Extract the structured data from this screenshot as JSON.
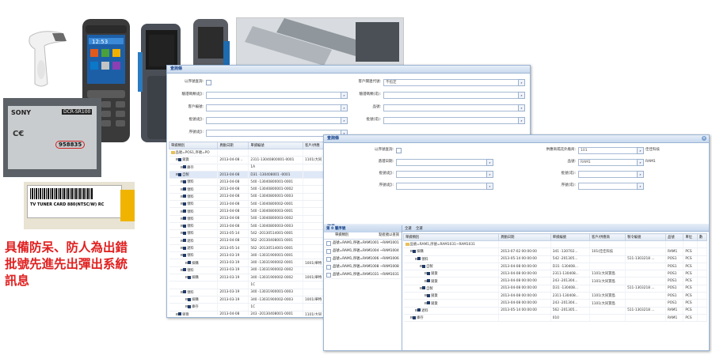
{
  "caption_lines": [
    "具備防呆、防人為出錯",
    "批號先進先出彈出系統",
    "訊息"
  ],
  "photos": {
    "device_label_brand": "SONY",
    "device_label_model": "DCR-SR100",
    "device_label_serial": "958835",
    "box_label_text": "TV TUNER CARD 880(NTSC/W) RC",
    "phone_time": "12:53"
  },
  "win1": {
    "title": "查詢條",
    "form_left": [
      {
        "label": "以序號查詢:",
        "type": "checkbox"
      },
      {
        "label": "驗證碼類(起):",
        "value": ""
      },
      {
        "label": "客戶編號:",
        "value": ""
      },
      {
        "label": "批號(起):",
        "value": ""
      },
      {
        "label": "序號(起):",
        "value": ""
      }
    ],
    "form_right": [
      {
        "label": "客戶關連代號:",
        "value": "不指定"
      },
      {
        "label": "驗證碼類(迄):",
        "value": ""
      },
      {
        "label": "品號:",
        "value": ""
      },
      {
        "label": "批號(迄):",
        "value": ""
      }
    ],
    "headers": [
      "單據類別",
      "異動日期",
      "單據編號",
      "客戶/供應"
    ],
    "rows": [
      {
        "tree": "品號=POS1,序號=PO",
        "date": "",
        "no": "",
        "cust": "",
        "level": 0,
        "icon": "folder"
      },
      {
        "tree": "銷貨",
        "date": "2013-04-08 ..",
        "no": "2311-13040800001-0001",
        "cust": "1101(大同",
        "level": 1,
        "icon": "node"
      },
      {
        "tree": "庫存",
        "date": "",
        "no": "1A",
        "cust": "",
        "level": 2,
        "icon": "node"
      },
      {
        "tree": "自製",
        "date": "2013-04-08",
        "no": "D31 -130408001 -0001",
        "cust": "",
        "level": 1,
        "icon": "node",
        "selected": true
      },
      {
        "tree": "領料",
        "date": "2013-04-08",
        "no": "540 -13040800001-0001",
        "cust": "",
        "level": 2,
        "icon": "node"
      },
      {
        "tree": "領料",
        "date": "2013-04-08",
        "no": "540 -13040800001-0002",
        "cust": "",
        "level": 2,
        "icon": "node"
      },
      {
        "tree": "領料",
        "date": "2013-04-08",
        "no": "540 -13040800001-0003",
        "cust": "",
        "level": 2,
        "icon": "node"
      },
      {
        "tree": "領料",
        "date": "2013-04-08",
        "no": "540 -13040800002-0001",
        "cust": "",
        "level": 2,
        "icon": "node"
      },
      {
        "tree": "領料",
        "date": "2013-04-08",
        "no": "540 -13040800003-0001",
        "cust": "",
        "level": 2,
        "icon": "node"
      },
      {
        "tree": "領料",
        "date": "2013-04-08",
        "no": "540 -13040800003-0002",
        "cust": "",
        "level": 2,
        "icon": "node"
      },
      {
        "tree": "領料",
        "date": "2013-04-08",
        "no": "540 -13040800003-0003",
        "cust": "",
        "level": 2,
        "icon": "node"
      },
      {
        "tree": "領料",
        "date": "2013-05-14",
        "no": "542 -20130514001-0001",
        "cust": "",
        "level": 2,
        "icon": "node"
      },
      {
        "tree": "退料",
        "date": "2013-04-08",
        "no": "562 -20130408001-0001",
        "cust": "",
        "level": 2,
        "icon": "node"
      },
      {
        "tree": "退料",
        "date": "2013-05-14",
        "no": "562 -20130514001-0001",
        "cust": "",
        "level": 2,
        "icon": "node"
      },
      {
        "tree": "領料",
        "date": "2013-03-19",
        "no": "340 -13031900001-0001",
        "cust": "",
        "level": 2,
        "icon": "node"
      },
      {
        "tree": "採購",
        "date": "2013-03-19",
        "no": "340 -13031900002-0001",
        "cust": "1001(華特",
        "level": 3,
        "icon": "node"
      },
      {
        "tree": "領料",
        "date": "2013-03-19",
        "no": "340 -13031900002-0002",
        "cust": "",
        "level": 2,
        "icon": "node"
      },
      {
        "tree": "採購",
        "date": "2013-03-19",
        "no": "340 -13031900002-0002",
        "cust": "1001(華特",
        "level": 3,
        "icon": "node"
      },
      {
        "tree": "",
        "date": "",
        "no": "1C",
        "cust": "",
        "level": 3,
        "icon": ""
      },
      {
        "tree": "領料",
        "date": "2013-03-19",
        "no": "340 -13031900001-0003",
        "cust": "",
        "level": 2,
        "icon": "node"
      },
      {
        "tree": "採購",
        "date": "2013-03-19",
        "no": "340 -13031900002-0003",
        "cust": "1001(華特",
        "level": 3,
        "icon": "node"
      },
      {
        "tree": "庫存",
        "date": "",
        "no": "1C",
        "cust": "",
        "level": 3,
        "icon": "node"
      },
      {
        "tree": "銷貨",
        "date": "2013-04-08",
        "no": "243 -20130408001-0001",
        "cust": "1101(大同",
        "level": 1,
        "icon": "node"
      }
    ]
  },
  "win2": {
    "title": "查詢條",
    "form_left": [
      {
        "label": "以序號查詢:",
        "type": "checkbox"
      },
      {
        "label": "憑證日期:",
        "value": ""
      },
      {
        "label": "批號(起):",
        "value": ""
      },
      {
        "label": "序號(起):",
        "value": ""
      }
    ],
    "form_right": [
      {
        "label": "供應商或託外廠商:",
        "value": "101",
        "extra": "佳佳科技"
      },
      {
        "label": "品號:",
        "value": "RAM1",
        "extra": "RAM1"
      },
      {
        "label": "批號(迄):",
        "value": ""
      },
      {
        "label": "序號(迄):",
        "value": ""
      }
    ],
    "result_title": "結果",
    "left_panel": {
      "header": "第 0 層序號",
      "sub_header": "點批號以查詢",
      "sub_header_label": "單據類別",
      "items": [
        "品號=RAM1,序號=RAM1001 ~RAM1001",
        "品號=RAM1,序號=RAM1004 ~RAM1004",
        "品號=RAM1,序號=RAM1006 ~RAM1006",
        "品號=RAM1,序號=RAM1008 ~RAM1008",
        "品號=RAM1,序號=RAM1031 ~RAM1031"
      ]
    },
    "tabs": [
      "全選",
      "全選"
    ],
    "headers": [
      "單據類別",
      "異動日期",
      "單據編號",
      "客戶/供應商",
      "製令編號",
      "品號",
      "單位",
      "數"
    ],
    "rows": [
      {
        "tree": "品號=RAM1,序號=RAM1031~RAM1031",
        "date": "",
        "no": "",
        "cust": "",
        "mo": "",
        "item": "",
        "unit": "",
        "level": 0,
        "icon": "folder"
      },
      {
        "tree": "採購",
        "date": "2013-07-02 00:00:00",
        "no": "341 -130702...",
        "cust": "101(佳佳科技",
        "mo": "",
        "item": "RAM1",
        "unit": "PCS",
        "level": 1,
        "icon": "node"
      },
      {
        "tree": "領料",
        "date": "2013-05-14 00:00:00",
        "no": "542 -201305...",
        "cust": "",
        "mo": "511-1303218 ...",
        "item": "POS1",
        "unit": "PCS",
        "level": 2,
        "icon": "node"
      },
      {
        "tree": "自製",
        "date": "2013-04-08 00:00:00",
        "no": "D31 -130408...",
        "cust": "",
        "mo": "",
        "item": "POS1",
        "unit": "PCS",
        "level": 3,
        "icon": "node"
      },
      {
        "tree": "銷貨",
        "date": "2013-04-08 00:00:00",
        "no": "2311-130408...",
        "cust": "1101(大同寶島",
        "mo": "",
        "item": "POS1",
        "unit": "PCS",
        "level": 4,
        "icon": "node"
      },
      {
        "tree": "銷貨",
        "date": "2013-04-08 00:00:00",
        "no": "243 -201304...",
        "cust": "1101(大同寶島",
        "mo": "",
        "item": "POS1",
        "unit": "PCS",
        "level": 4,
        "icon": "node"
      },
      {
        "tree": "自製",
        "date": "2013-04-08 00:00:00",
        "no": "D31 -130408...",
        "cust": "",
        "mo": "511-1303218 ...",
        "item": "POS1",
        "unit": "PCS",
        "level": 3,
        "icon": "node"
      },
      {
        "tree": "銷貨",
        "date": "2013-04-08 00:00:00",
        "no": "2311-130408...",
        "cust": "1101(大同寶島",
        "mo": "",
        "item": "POS1",
        "unit": "PCS",
        "level": 4,
        "icon": "node"
      },
      {
        "tree": "銷貨",
        "date": "2013-04-08 00:00:00",
        "no": "243 -201304...",
        "cust": "1101(大同寶島",
        "mo": "",
        "item": "POS1",
        "unit": "PCS",
        "level": 4,
        "icon": "node"
      },
      {
        "tree": "退料",
        "date": "2013-05-14 00:00:00",
        "no": "562 -201305...",
        "cust": "",
        "mo": "511-1303218 ...",
        "item": "RAM1",
        "unit": "PCS",
        "level": 2,
        "icon": "node"
      },
      {
        "tree": "庫存",
        "date": "",
        "no": "010",
        "cust": "",
        "mo": "",
        "item": "RAM1",
        "unit": "PCS",
        "level": 1,
        "icon": "node"
      }
    ]
  }
}
